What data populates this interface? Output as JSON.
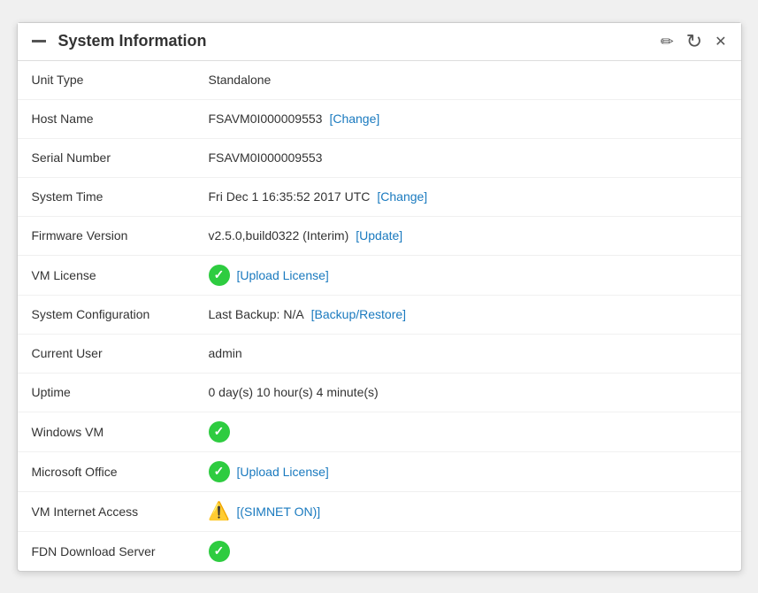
{
  "panel": {
    "title": "System Information",
    "header": {
      "dash_label": "—",
      "edit_icon": "✏",
      "refresh_icon": "↻",
      "close_icon": "✕"
    },
    "rows": [
      {
        "label": "Unit Type",
        "value": "Standalone",
        "type": "text",
        "action": null
      },
      {
        "label": "Host Name",
        "value": "FSAVM0I000009553",
        "type": "text-link",
        "action": "[Change]"
      },
      {
        "label": "Serial Number",
        "value": "FSAVM0I000009553",
        "type": "text",
        "action": null
      },
      {
        "label": "System Time",
        "value": "Fri Dec 1 16:35:52 2017 UTC",
        "type": "text-link",
        "action": "[Change]"
      },
      {
        "label": "Firmware Version",
        "value": "v2.5.0,build0322 (Interim)",
        "type": "text-link",
        "action": "[Update]"
      },
      {
        "label": "VM License",
        "value": "",
        "type": "check-link",
        "action": "[Upload License]"
      },
      {
        "label": "System Configuration",
        "value": "Last Backup: N/A",
        "type": "text-link",
        "action": "[Backup/Restore]"
      },
      {
        "label": "Current User",
        "value": "admin",
        "type": "text",
        "action": null
      },
      {
        "label": "Uptime",
        "value": "0 day(s) 10 hour(s) 4 minute(s)",
        "type": "text",
        "action": null
      },
      {
        "label": "Windows VM",
        "value": "",
        "type": "check",
        "action": null
      },
      {
        "label": "Microsoft Office",
        "value": "",
        "type": "check-link",
        "action": "[Upload License]"
      },
      {
        "label": "VM Internet Access",
        "value": "",
        "type": "warn-link",
        "action": "[(SIMNET ON)]"
      },
      {
        "label": "FDN Download Server",
        "value": "",
        "type": "check",
        "action": null
      }
    ]
  }
}
